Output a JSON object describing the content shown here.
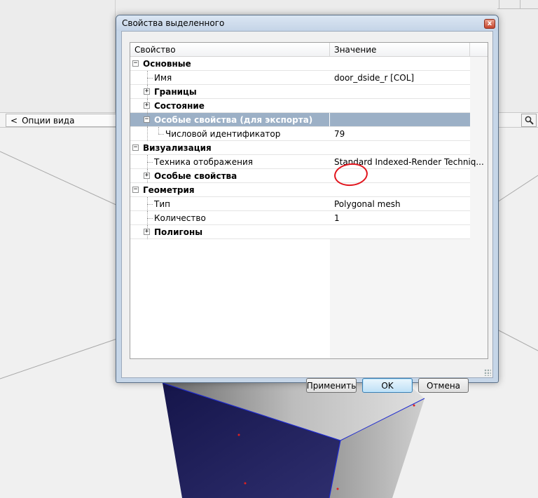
{
  "app": {
    "view_options_label": "Опции вида",
    "view_options_chevron": "<",
    "search_icon": "magnifier-icon"
  },
  "dialog": {
    "title": "Свойства выделенного",
    "close_glyph": "x",
    "columns": {
      "property": "Свойство",
      "value": "Значение"
    },
    "rows": [
      {
        "label": "Основные",
        "bold": true,
        "level": 0,
        "toggle": "−",
        "value": ""
      },
      {
        "label": "Имя",
        "bold": false,
        "level": 1,
        "toggle": "",
        "value": "door_dside_r [COL]"
      },
      {
        "label": "Границы",
        "bold": true,
        "level": 1,
        "toggle": "+",
        "value": ""
      },
      {
        "label": "Состояние",
        "bold": true,
        "level": 1,
        "toggle": "+",
        "value": ""
      },
      {
        "label": "Особые свойства (для экспорта)",
        "bold": true,
        "level": 1,
        "toggle": "−",
        "value": "",
        "selected": true
      },
      {
        "label": "Числовой идентификатор",
        "bold": false,
        "level": 2,
        "toggle": "",
        "value": "79"
      },
      {
        "label": "Визуализация",
        "bold": true,
        "level": 0,
        "toggle": "−",
        "value": ""
      },
      {
        "label": "Техника отображения",
        "bold": false,
        "level": 1,
        "toggle": "",
        "value": "Standard Indexed-Render Techniq..."
      },
      {
        "label": "Особые свойства",
        "bold": true,
        "level": 1,
        "toggle": "+",
        "value": ""
      },
      {
        "label": "Геометрия",
        "bold": true,
        "level": 0,
        "toggle": "−",
        "value": ""
      },
      {
        "label": "Тип",
        "bold": false,
        "level": 1,
        "toggle": "",
        "value": "Polygonal mesh"
      },
      {
        "label": "Количество",
        "bold": false,
        "level": 1,
        "toggle": "",
        "value": "1"
      },
      {
        "label": "Полигоны",
        "bold": true,
        "level": 1,
        "toggle": "+",
        "value": ""
      }
    ],
    "buttons": {
      "apply": "Применить",
      "ok": "OK",
      "cancel": "Отмена"
    }
  },
  "colors": {
    "selection": "#9cb0c6",
    "annotation": "#e1141c",
    "mesh_face": "#1c1c5c"
  }
}
